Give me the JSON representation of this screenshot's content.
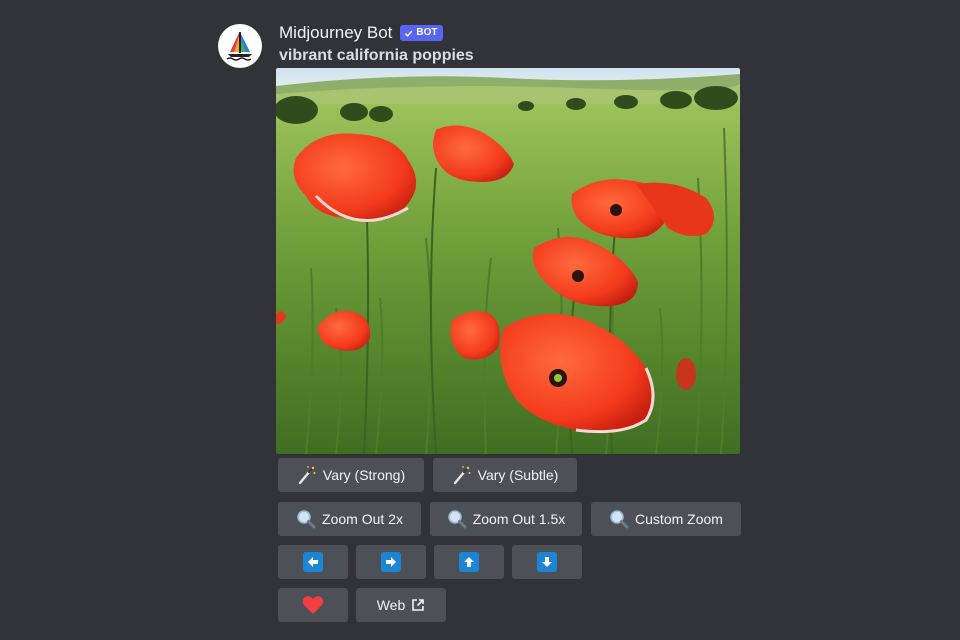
{
  "message": {
    "author": "Midjourney Bot",
    "badge": "BOT",
    "prompt": "vibrant california poppies",
    "image_alt": "Red poppies in a green meadow"
  },
  "buttons": {
    "vary_strong": "Vary (Strong)",
    "vary_subtle": "Vary (Subtle)",
    "zoom_out_2x": "Zoom Out 2x",
    "zoom_out_15x": "Zoom Out 1.5x",
    "custom_zoom": "Custom Zoom",
    "web": "Web"
  },
  "icons": {
    "vary": "magic-wand-icon",
    "zoom": "magnifier-icon",
    "pan_left": "arrow-left-icon",
    "pan_right": "arrow-right-icon",
    "pan_up": "arrow-up-icon",
    "pan_down": "arrow-down-icon",
    "favorite": "heart-icon",
    "external": "external-link-icon"
  },
  "colors": {
    "background": "#313338",
    "button": "#4e5058",
    "badge": "#5865f2",
    "arrow": "#1d86d4",
    "heart": "#f23f43"
  }
}
